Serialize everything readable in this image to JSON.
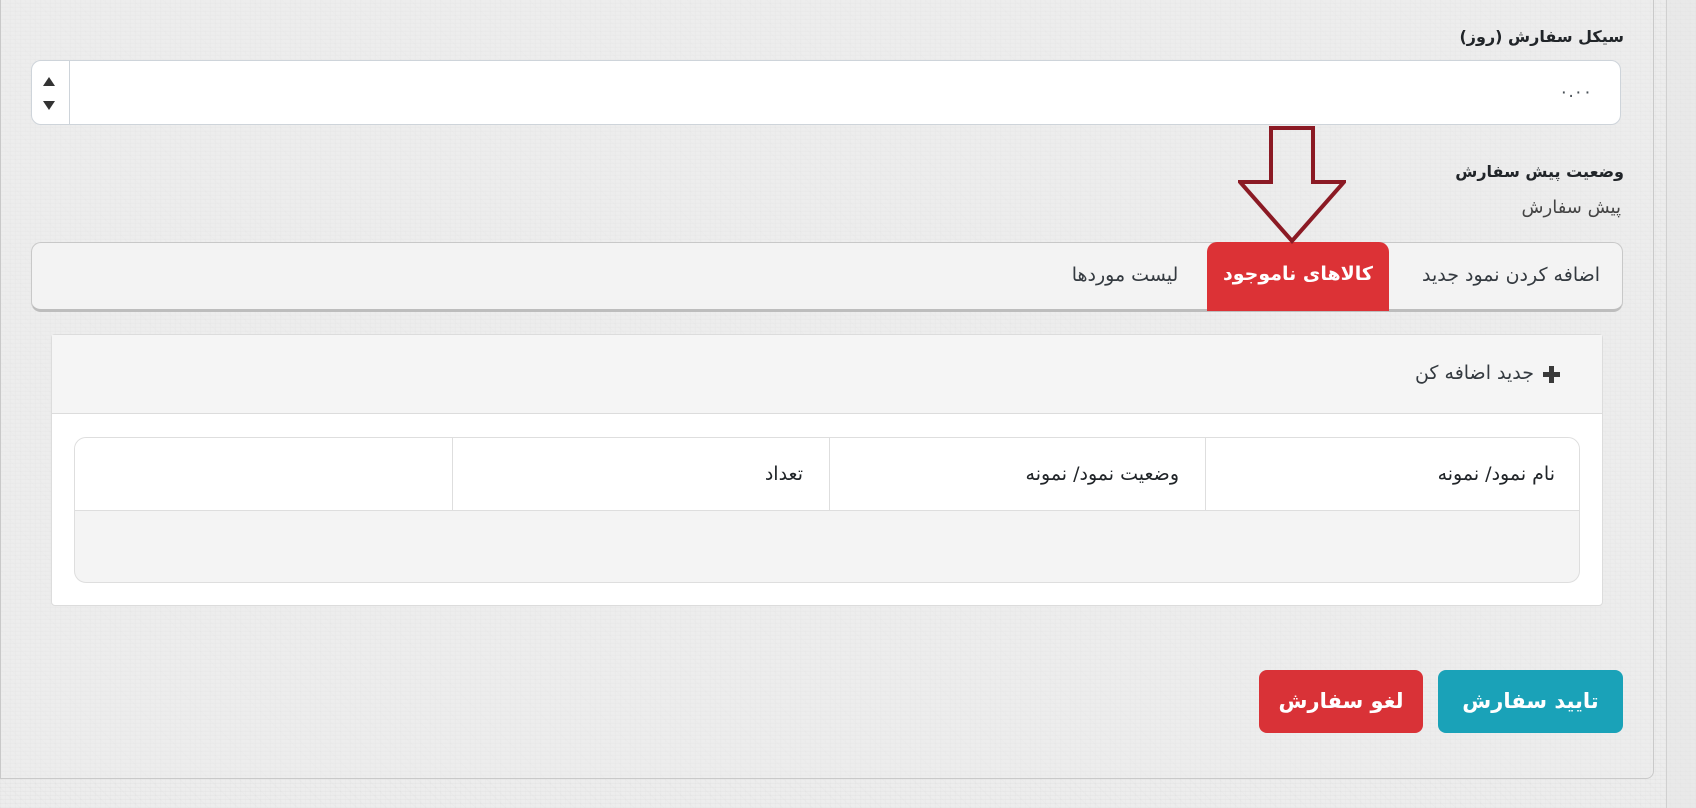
{
  "form": {
    "order_cycle_label": "سیکل سفارش (روز)",
    "order_cycle_value": "۰.۰۰",
    "preorder_status_label": "وضعیت پیش سفارش",
    "preorder_status_value": "پیش سفارش"
  },
  "tabs": [
    {
      "label": "اضافه کردن نمود جدید",
      "active": false
    },
    {
      "label": "کالاهای ناموجود",
      "active": true
    },
    {
      "label": "لیست موردها",
      "active": false
    }
  ],
  "panel": {
    "add_new_label": "جدید اضافه کن",
    "add_new_icon": "plus-icon",
    "table": {
      "columns": [
        "نام نمود/ نمونه",
        "وضعیت نمود/ نمونه",
        "تعداد",
        ""
      ],
      "rows": []
    }
  },
  "actions": {
    "confirm_label": "تایید سفارش",
    "cancel_label": "لغو سفارش"
  },
  "colors": {
    "active_tab": "#dc3236",
    "confirm_button": "#1aa2b8",
    "cancel_button": "#d93237",
    "annotation_arrow": "#8b1a24"
  }
}
